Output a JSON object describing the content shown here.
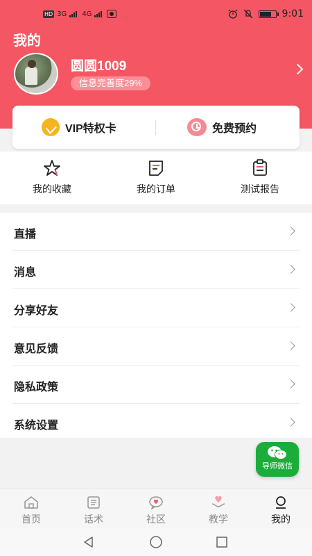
{
  "status_bar": {
    "network_hd": "HD",
    "sim1": "3G",
    "sim2": "4G",
    "time": "9:01"
  },
  "header": {
    "title": "我的",
    "username": "圆圆1009",
    "completeness": "信息完善度29%"
  },
  "card": {
    "vip_label": "VIP特权卡",
    "appointment_label": "免费预约"
  },
  "quick_actions": [
    {
      "label": "我的收藏",
      "icon": "star-icon"
    },
    {
      "label": "我的订单",
      "icon": "order-icon"
    },
    {
      "label": "测试报告",
      "icon": "report-icon"
    }
  ],
  "menu": [
    {
      "label": "直播"
    },
    {
      "label": "消息"
    },
    {
      "label": "分享好友"
    },
    {
      "label": "意见反馈"
    },
    {
      "label": "隐私政策"
    },
    {
      "label": "系统设置"
    }
  ],
  "floating": {
    "label": "导师微信"
  },
  "tabs": [
    {
      "label": "首页",
      "icon": "home-icon"
    },
    {
      "label": "话术",
      "icon": "script-icon"
    },
    {
      "label": "社区",
      "icon": "community-icon"
    },
    {
      "label": "教学",
      "icon": "teaching-icon"
    },
    {
      "label": "我的",
      "icon": "profile-icon",
      "active": true
    }
  ],
  "colors": {
    "brand": "#f45763",
    "wechat": "#1aad3a",
    "vip": "#f5b520"
  }
}
